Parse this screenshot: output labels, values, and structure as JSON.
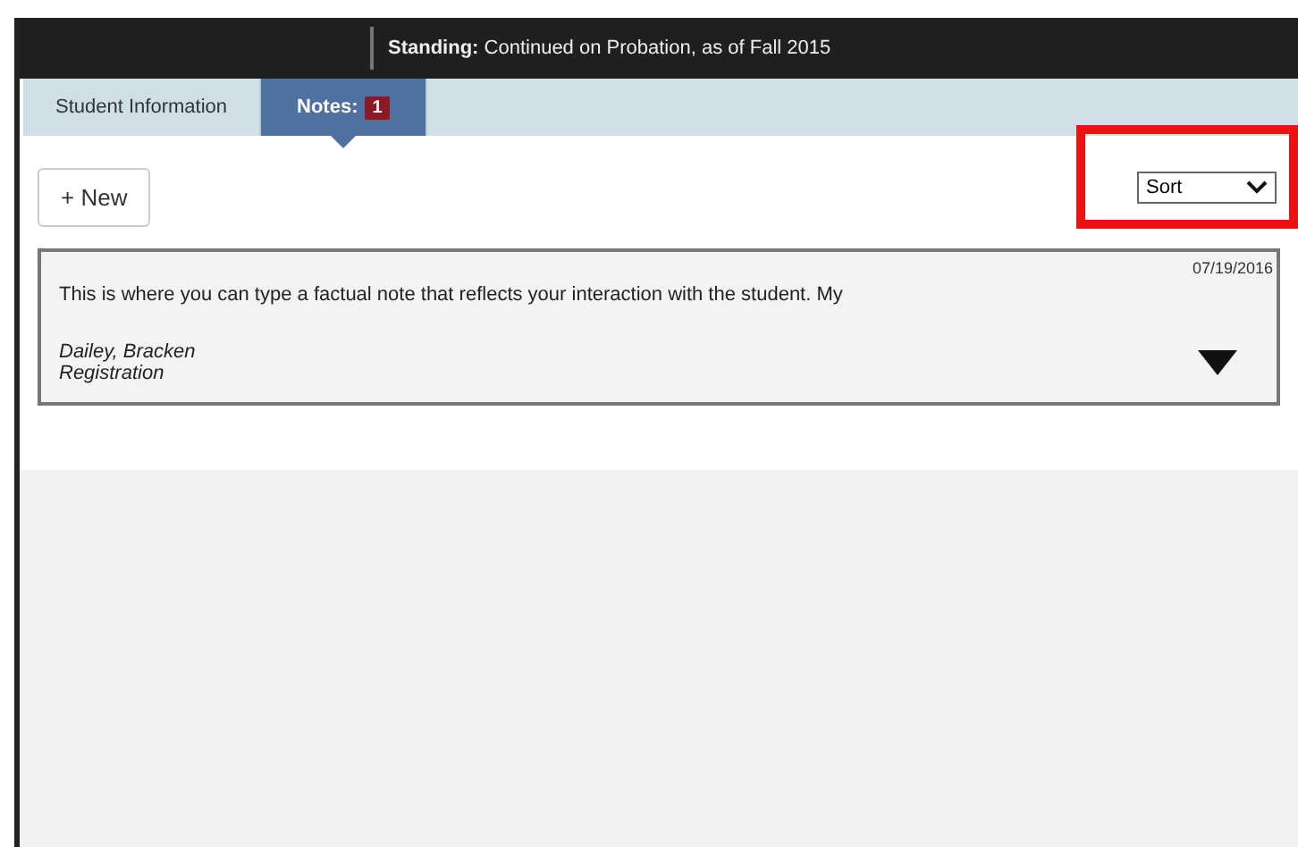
{
  "header": {
    "standing": "**Standing:** Continued on Probation, as of Fall 2015"
  },
  "tabs": [
    {
      "label": "Student Information",
      "selected": false
    },
    {
      "label": "Notes:",
      "selected": true,
      "badge": "1"
    }
  ],
  "toolbar": {
    "new_button": "+ New",
    "sort": {
      "value": "Sort",
      "highlighted": true
    }
  },
  "notes": [
    {
      "date": "07/19/2016",
      "text": "This is where you can type a factual note that reflects your interaction with the student. My",
      "author": "Dailey, Bracken",
      "category": "Registration",
      "expanded": false
    }
  ]
}
